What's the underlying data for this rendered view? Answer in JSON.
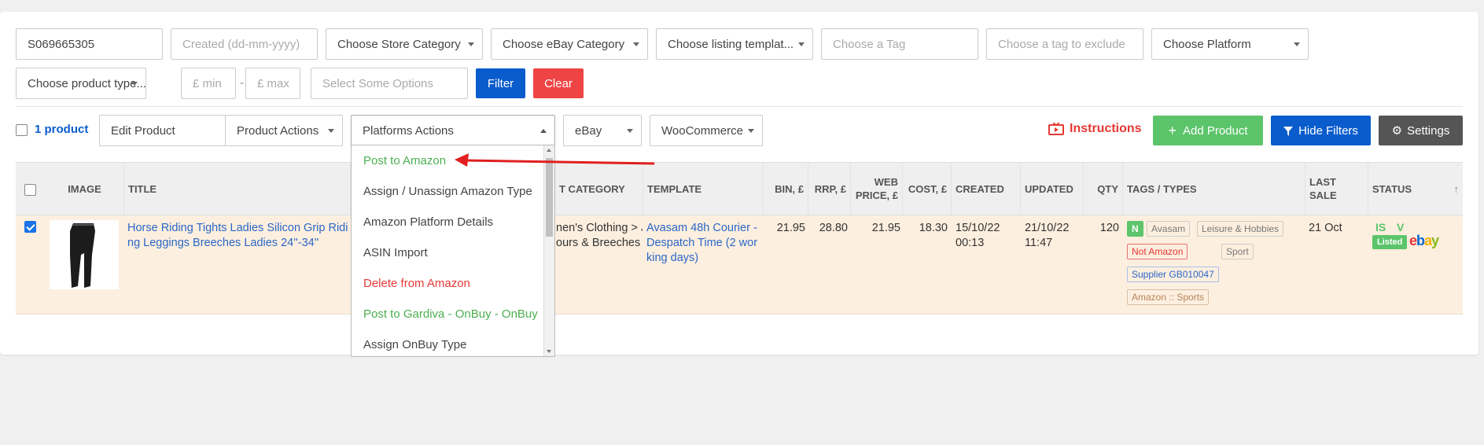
{
  "filters": {
    "sku_value": "S069665305",
    "created_placeholder": "Created (dd-mm-yyyy)",
    "store_category": "Choose Store Category",
    "ebay_category": "Choose eBay Category",
    "listing_template": "Choose listing templat...",
    "tag_placeholder": "Choose a Tag",
    "exclude_tag_placeholder": "Choose a tag to exclude",
    "platform": "Choose Platform",
    "product_type": "Choose product type...",
    "min_placeholder": "£ min",
    "range_sep": "-",
    "max_placeholder": "£ max",
    "options_placeholder": "Select Some Options",
    "filter_label": "Filter",
    "clear_label": "Clear"
  },
  "toolbar": {
    "product_count": "1 product",
    "edit_product": "Edit Product",
    "product_actions": "Product Actions",
    "platforms_actions": "Platforms Actions",
    "ebay": "eBay",
    "woocommerce": "WooCommerce",
    "instructions": "Instructions",
    "add_product": "Add Product",
    "hide_filters": "Hide Filters",
    "settings": "Settings"
  },
  "dropdown": {
    "items": [
      {
        "label": "Post to Amazon",
        "color": "#4caf50"
      },
      {
        "label": "Assign / Unassign Amazon Type",
        "color": "#444444"
      },
      {
        "label": "Amazon Platform Details",
        "color": "#444444"
      },
      {
        "label": "ASIN Import",
        "color": "#444444"
      },
      {
        "label": "Delete from Amazon",
        "color": "#e53935"
      },
      {
        "label": "Post to Gardiva - OnBuy - OnBuy",
        "color": "#4caf50"
      },
      {
        "label": "Assign OnBuy Type",
        "color": "#444444"
      }
    ]
  },
  "table": {
    "headers": {
      "image": "IMAGE",
      "title": "TITLE",
      "category": "T CATEGORY",
      "template": "TEMPLATE",
      "bin": "BIN, £",
      "rrp": "RRP, £",
      "web_price_1": "WEB",
      "web_price_2": "PRICE, £",
      "cost": "COST, £",
      "created": "CREATED",
      "updated": "UPDATED",
      "qty": "QTY",
      "tags": "TAGS / TYPES",
      "last_sale": "LAST SALE",
      "status": "STATUS",
      "sort_icon": "↑"
    },
    "row": {
      "title_1": "Horse Riding Tights Ladies Silicon Grip Ridi",
      "title_2": "ng Leggings Breeches Ladies 24''-34''",
      "category_1": "nen's Clothing > J",
      "category_2": "ours & Breeches",
      "template_1": "Avasam 48h Courier -",
      "template_2": "Despatch Time (2 wor",
      "template_3": "king days)",
      "bin": "21.95",
      "rrp": "28.80",
      "web_price": "21.95",
      "cost": "18.30",
      "created_date": "15/10/22",
      "created_time": "00:13",
      "updated_date": "21/10/22",
      "updated_time": "11:47",
      "qty": "120",
      "tag_n": "N",
      "tag_avasam": "Avasam",
      "tag_leisure": "Leisure & Hobbies",
      "tag_not_amazon": "Not Amazon",
      "tag_sport": "Sport",
      "tag_supplier": "Supplier GB010047",
      "tag_amazon_sports": "Amazon :: Sports",
      "last_sale": "21 Oct",
      "status_is": "IS",
      "status_v": "V",
      "status_listed": "Listed",
      "ebay_e": "e",
      "ebay_b": "b",
      "ebay_a": "a",
      "ebay_y": "y"
    }
  },
  "colors": {
    "primary": "#0a5ccd",
    "danger": "#ef4444",
    "success": "#5cc46a",
    "dark": "#555555",
    "selected_row": "#fdefdf",
    "arrow": "#e02020"
  },
  "icons": [
    "tv-icon",
    "plus-icon",
    "filter-icon",
    "gear-icon",
    "sort-up-icon",
    "red-arrow"
  ]
}
